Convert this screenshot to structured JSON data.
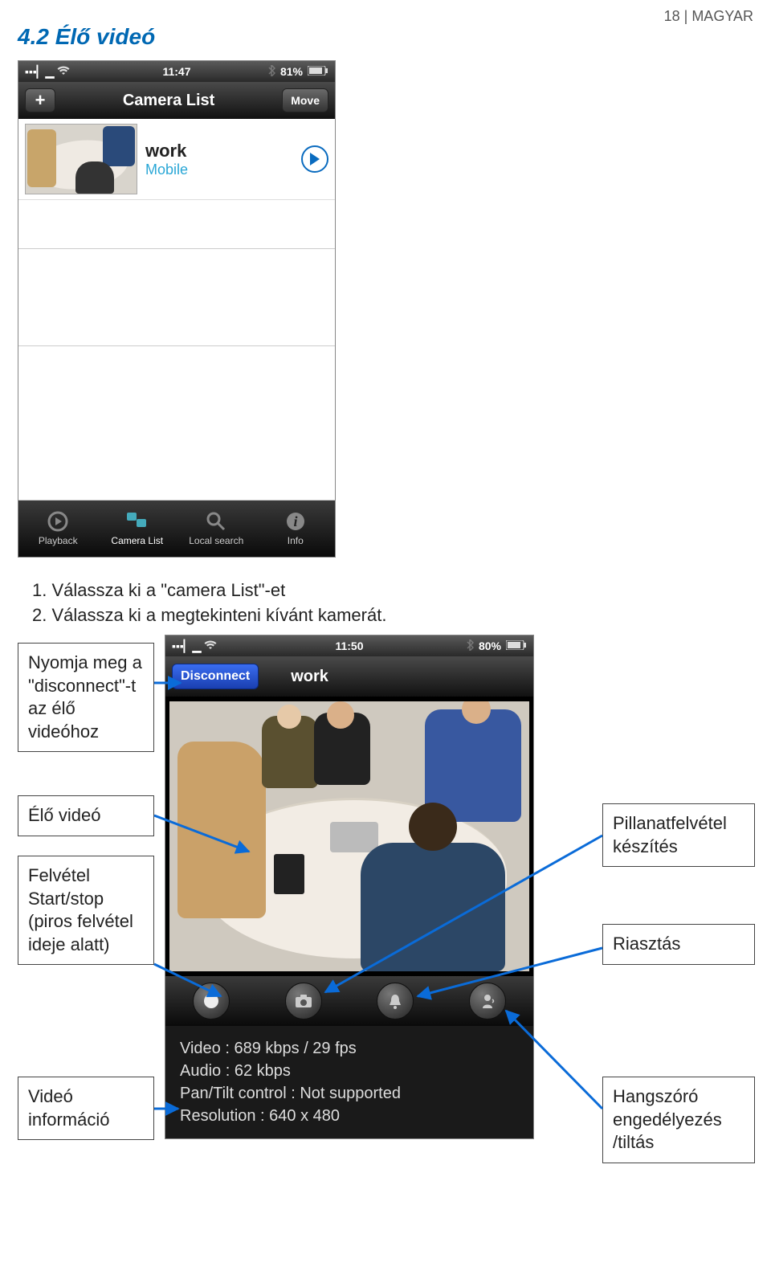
{
  "header": {
    "page_no": "18",
    "lang": "MAGYAR"
  },
  "section_title": "4.2 Élő videó",
  "phone1": {
    "status": {
      "time": "11:47",
      "battery": "81%"
    },
    "nav": {
      "add": "+",
      "title": "Camera List",
      "move": "Move"
    },
    "item": {
      "name": "work",
      "sub": "Mobile"
    },
    "tabs": {
      "playback": "Playback",
      "camlist": "Camera List",
      "local": "Local search",
      "info": "Info"
    }
  },
  "instructions": {
    "l1": "1.   Válassza ki a \"camera List\"-et",
    "l2": "2.   Válassza ki a megtekinteni kívánt kamerát."
  },
  "callouts": {
    "c1": "Nyomja meg a \"disconnect\"-t az élő videóhoz",
    "c2": "Élő videó",
    "c3": "Felvétel Start/stop (piros felvétel ideje alatt)",
    "c4": "Videó információ",
    "c5": "Pillanatfelvétel készítés",
    "c6": "Riasztás",
    "c7": "Hangszóró engedélyezés /tiltás"
  },
  "phone2": {
    "status": {
      "time": "11:50",
      "battery": "80%"
    },
    "nav": {
      "disconnect": "Disconnect",
      "title": "work"
    },
    "info": {
      "video": "Video : 689 kbps / 29 fps",
      "audio": "Audio : 62 kbps",
      "pantilt": "Pan/Tilt control : Not supported",
      "resolution": "Resolution : 640 x 480"
    }
  },
  "chart_data": {
    "type": "table",
    "title": "Live video stream info",
    "rows": [
      {
        "label": "Video",
        "value": "689 kbps / 29 fps"
      },
      {
        "label": "Audio",
        "value": "62 kbps"
      },
      {
        "label": "Pan/Tilt control",
        "value": "Not supported"
      },
      {
        "label": "Resolution",
        "value": "640 x 480"
      }
    ]
  }
}
